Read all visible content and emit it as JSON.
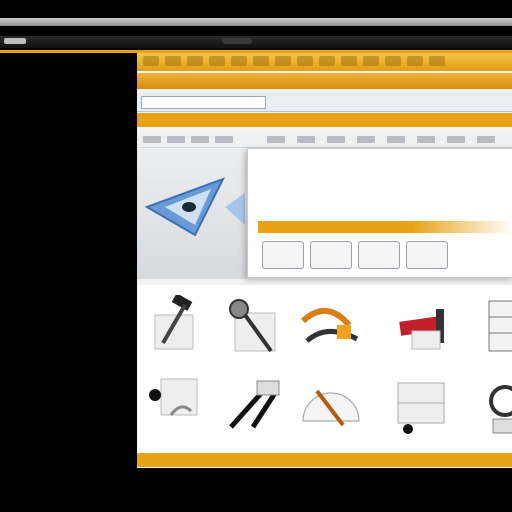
{
  "window": {
    "address_text": "",
    "band_label": "",
    "dialog_title": "",
    "dialog_subtitle": "",
    "dialog_button_label": "",
    "status_text": ""
  },
  "colors": {
    "accent": "#e8a215",
    "ribbon": "#f2b23a",
    "background": "#000000",
    "icon_blue": "#6a9ad6"
  },
  "tools": [
    {
      "name": "hammer-icon"
    },
    {
      "name": "magnifier-icon"
    },
    {
      "name": "pliers-icon"
    },
    {
      "name": "clamp-icon"
    },
    {
      "name": "cabinet-icon"
    },
    {
      "name": "wrench-icon"
    },
    {
      "name": "scissors-icon"
    },
    {
      "name": "protractor-icon"
    },
    {
      "name": "toolbox-icon"
    },
    {
      "name": "gauge-icon"
    }
  ]
}
